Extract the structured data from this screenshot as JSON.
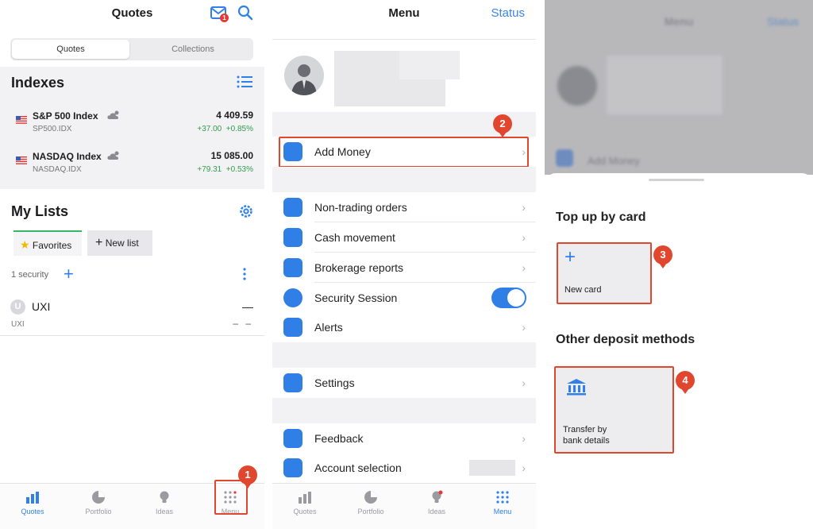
{
  "quotes_screen": {
    "title": "Quotes",
    "mail_badge": "1",
    "segments": [
      "Quotes",
      "Collections"
    ],
    "indexes_title": "Indexes",
    "indexes": [
      {
        "name": "S&P 500 Index",
        "ticker": "SP500.IDX",
        "price": "4 409.59",
        "change": "+37.00",
        "change_pct": "+0.85%"
      },
      {
        "name": "NASDAQ Index",
        "ticker": "NASDAQ.IDX",
        "price": "15 085.00",
        "change": "+79.31",
        "change_pct": "+0.53%"
      }
    ],
    "my_lists_title": "My Lists",
    "list_tabs": {
      "favorites": "Favorites",
      "new_list": "New list"
    },
    "security_count": "1 security",
    "security": {
      "logo_letter": "U",
      "name": "UXI",
      "ticker": "UXI",
      "price": "—",
      "change": "– –"
    },
    "tabbar": [
      "Quotes",
      "Portfolio",
      "Ideas",
      "Menu"
    ]
  },
  "menu_screen": {
    "title": "Menu",
    "status": "Status",
    "items": [
      "Add Money",
      "Non-trading orders",
      "Cash movement",
      "Brokerage reports",
      "Security Session",
      "Alerts",
      "Settings",
      "Feedback",
      "Account selection"
    ],
    "tabbar": [
      "Quotes",
      "Portfolio",
      "Ideas",
      "Menu"
    ]
  },
  "deposit_sheet": {
    "bg_title": "Menu",
    "bg_status": "Status",
    "bg_item": "Add Money",
    "card_section": "Top up by card",
    "new_card": "New card",
    "other_section": "Other deposit methods",
    "bank_line1": "Transfer by",
    "bank_line2": "bank details"
  },
  "steps": [
    "1",
    "2",
    "3",
    "4"
  ],
  "colors": {
    "accent": "#2f80ed",
    "highlight": "#e0472e",
    "positive": "#2e9d4b"
  }
}
